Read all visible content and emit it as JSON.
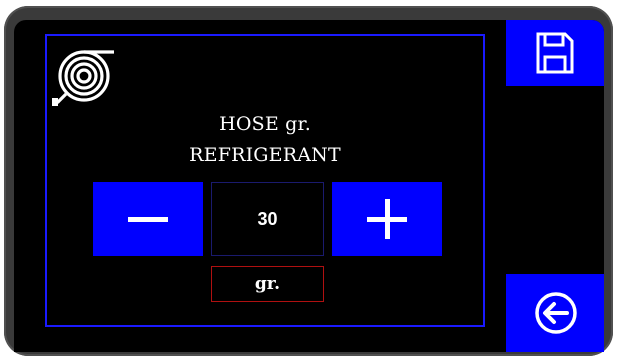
{
  "panel": {
    "title_line1": "HOSE gr.",
    "title_line2": "REFRIGERANT"
  },
  "stepper": {
    "value": "30",
    "unit": "gr.",
    "decrement_icon": "minus-icon",
    "increment_icon": "plus-icon"
  },
  "side": {
    "save_icon": "floppy-disk-icon",
    "back_icon": "arrow-left-circle-icon"
  },
  "icons": {
    "panel_icon": "hose-reel-icon"
  },
  "colors": {
    "accent": "#0000ff",
    "background": "#000000",
    "unit_border": "#b01010",
    "text": "#ffffff"
  }
}
